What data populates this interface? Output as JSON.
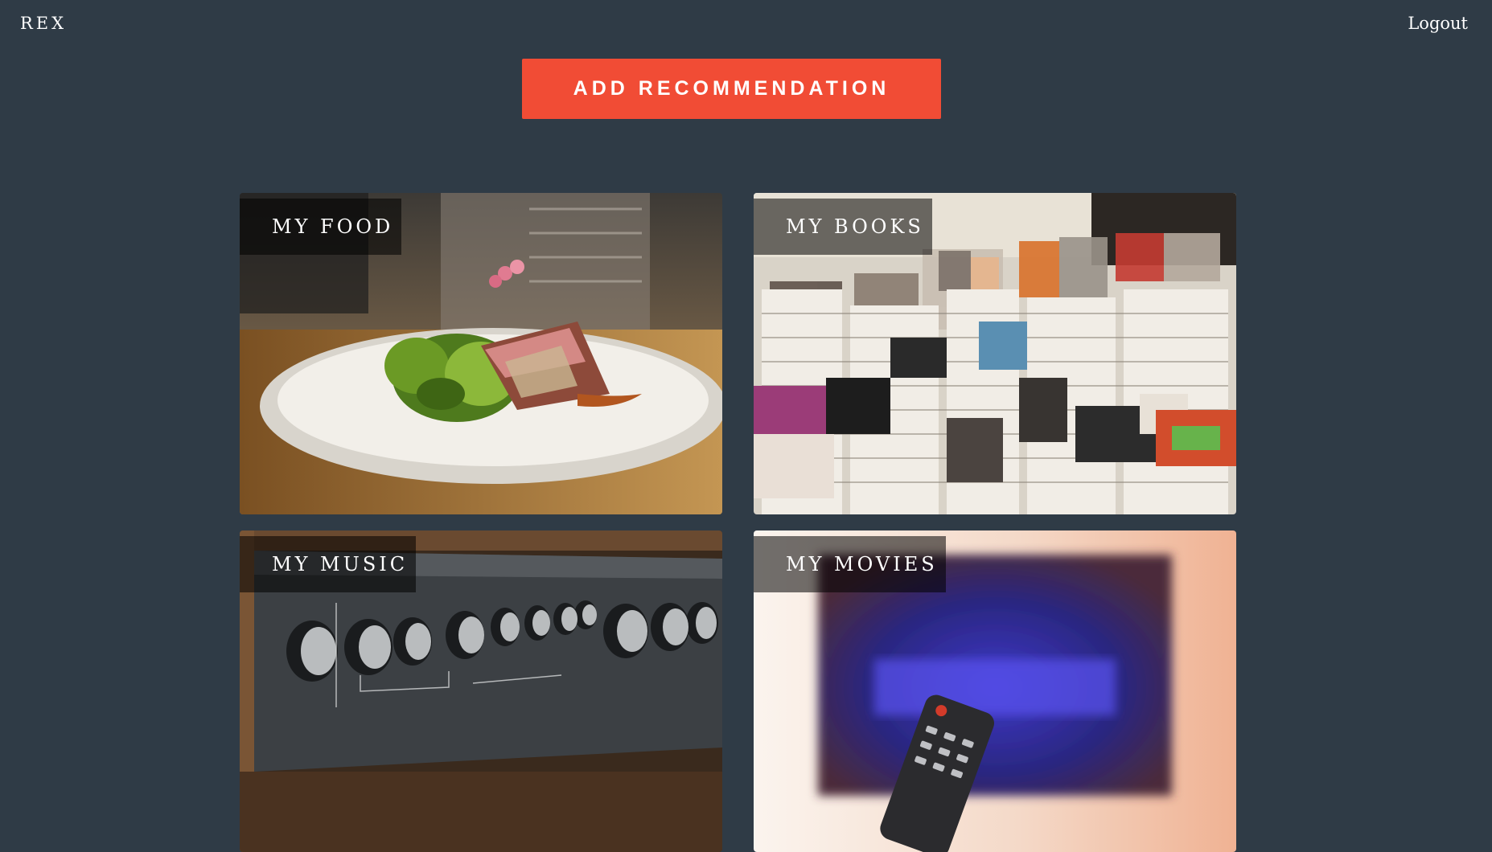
{
  "nav": {
    "brand": "REX",
    "logout": "Logout"
  },
  "actions": {
    "add_recommendation": "ADD RECOMMENDATION"
  },
  "colors": {
    "background": "#2f3b46",
    "accent": "#f14c35"
  },
  "cards": [
    {
      "label": "MY FOOD"
    },
    {
      "label": "MY BOOKS"
    },
    {
      "label": "MY MUSIC"
    },
    {
      "label": "MY MOVIES"
    }
  ]
}
